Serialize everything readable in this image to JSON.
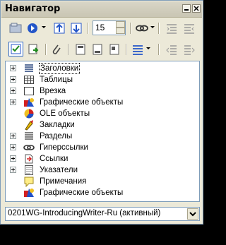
{
  "window": {
    "title": "Навигатор"
  },
  "toolbar": {
    "heading_levels_value": "15"
  },
  "tree": {
    "items": [
      {
        "label": "Заголовки",
        "expandable": true,
        "selected": true,
        "icon": "headings-icon"
      },
      {
        "label": "Таблицы",
        "expandable": true,
        "icon": "table-icon"
      },
      {
        "label": "Врезка",
        "expandable": true,
        "icon": "frame-icon"
      },
      {
        "label": "Графические объекты",
        "expandable": true,
        "icon": "graphics-icon"
      },
      {
        "label": "OLE объекты",
        "expandable": false,
        "icon": "ole-icon"
      },
      {
        "label": "Закладки",
        "expandable": false,
        "icon": "bookmark-icon"
      },
      {
        "label": "Разделы",
        "expandable": true,
        "icon": "section-icon"
      },
      {
        "label": "Гиперссылки",
        "expandable": true,
        "icon": "hyperlink-icon"
      },
      {
        "label": "Ссылки",
        "expandable": true,
        "icon": "reference-icon"
      },
      {
        "label": "Указатели",
        "expandable": true,
        "icon": "index-icon"
      },
      {
        "label": "Примечания",
        "expandable": false,
        "icon": "note-icon"
      },
      {
        "label": "Графические объекты",
        "expandable": false,
        "icon": "drawing-objects-icon"
      }
    ]
  },
  "document_select": {
    "value": "0201WG-IntroducingWriter-Ru (активный)"
  }
}
